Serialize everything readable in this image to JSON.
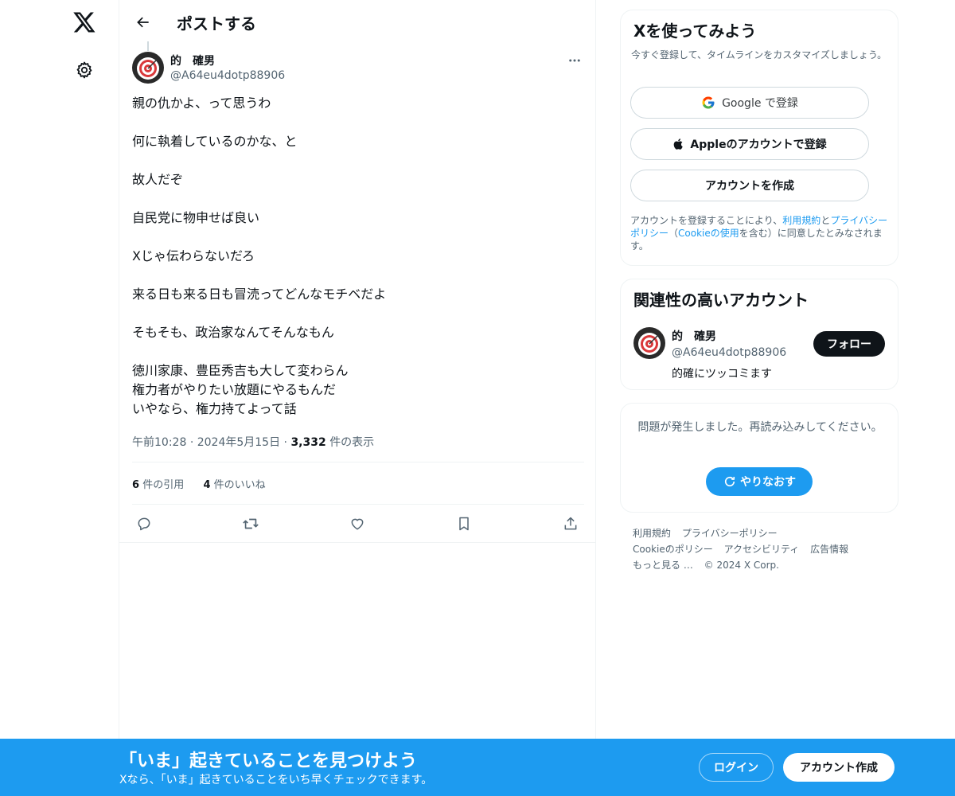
{
  "header": {
    "title": "ポストする"
  },
  "post": {
    "author_name": "的　確男",
    "author_handle": "@A64eu4dotp88906",
    "paragraphs": [
      [
        "親の仇かよ、って思うわ"
      ],
      [
        "何に執着しているのかな、と"
      ],
      [
        "故人だぞ"
      ],
      [
        "自民党に物申せば良い"
      ],
      [
        "Xじゃ伝わらないだろ"
      ],
      [
        "来る日も来る日も冒涜ってどんなモチベだよ"
      ],
      [
        "そもそも、政治家なんてそんなもん"
      ],
      [
        "徳川家康、豊臣秀吉も大して変わらん",
        "権力者がやりたい放題にやるもんだ",
        "いやなら、権力持てよって話"
      ]
    ],
    "time": "午前10:28",
    "date": "2024年5月15日",
    "views_count": "3,332",
    "views_label": "件の表示",
    "quotes_count": "6",
    "quotes_label": "件の引用",
    "likes_count": "4",
    "likes_label": "件のいいね"
  },
  "signup_card": {
    "title": "Xを使ってみよう",
    "subtitle": "今すぐ登録して、タイムラインをカスタマイズしましょう。",
    "google_label": "Google で登録",
    "apple_label": "Appleのアカウントで登録",
    "create_label": "アカウントを作成",
    "legal_pre": "アカウントを登録することにより、",
    "legal_terms": "利用規約",
    "legal_and": "と",
    "legal_privacy": "プライバシーポリシー",
    "legal_paren_open": "（",
    "legal_cookie": "Cookieの使用",
    "legal_post": "を含む）に同意したとみなされます。"
  },
  "related": {
    "title": "関連性の高いアカウント",
    "name": "的　確男",
    "handle": "@A64eu4dotp88906",
    "bio": "的確にツッコミます",
    "follow_label": "フォロー"
  },
  "error_card": {
    "message": "問題が発生しました。再読み込みしてください。",
    "retry_label": "やりなおす"
  },
  "footer": {
    "links": [
      "利用規約",
      "プライバシーポリシー",
      "Cookieのポリシー",
      "アクセシビリティ",
      "広告情報",
      "もっと見る …",
      "© 2024 X Corp."
    ]
  },
  "bottom_bar": {
    "title": "「いま」起きていることを見つけよう",
    "subtitle": "Xなら、「いま」起きていることをいち早くチェックできます。",
    "login_label": "ログイン",
    "signup_label": "アカウント作成"
  },
  "colors": {
    "accent": "#1d9bf0",
    "text": "#0f1419",
    "muted": "#536471",
    "border": "#eff3f4"
  },
  "icons": [
    "x-logo-icon",
    "gear-icon",
    "back-arrow-icon",
    "more-icon",
    "reply-icon",
    "repost-icon",
    "like-icon",
    "bookmark-icon",
    "share-icon",
    "google-icon",
    "apple-icon",
    "refresh-icon"
  ]
}
